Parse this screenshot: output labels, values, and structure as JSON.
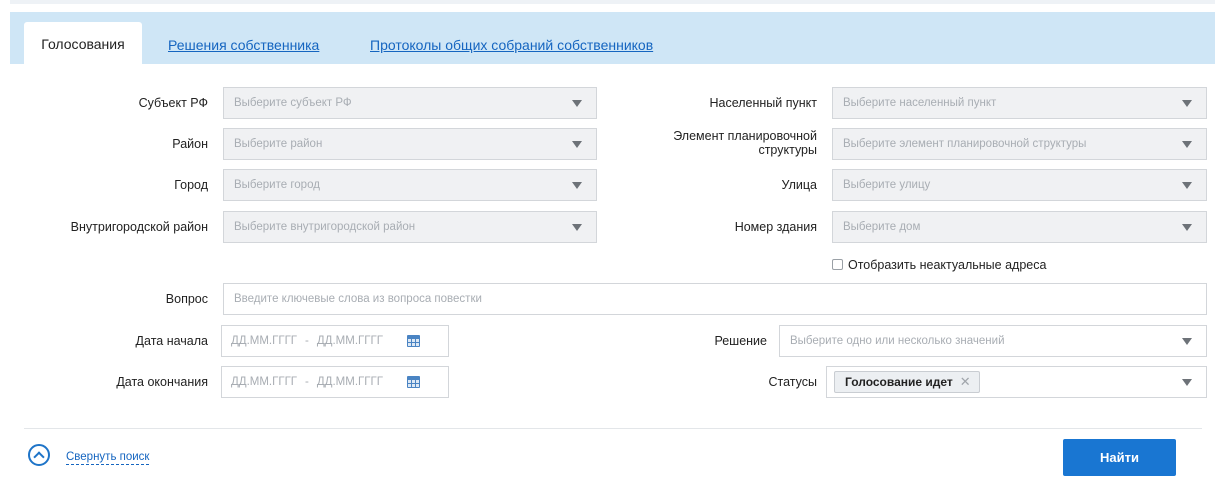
{
  "tabs": [
    {
      "label": "Голосования",
      "active": true
    },
    {
      "label": "Решения собственника",
      "active": false
    },
    {
      "label": "Протоколы общих собраний собственников",
      "active": false
    }
  ],
  "filters": {
    "subject": {
      "label": "Субъект РФ",
      "placeholder": "Выберите субъект РФ"
    },
    "district": {
      "label": "Район",
      "placeholder": "Выберите район"
    },
    "city": {
      "label": "Город",
      "placeholder": "Выберите город"
    },
    "inner_district": {
      "label": "Внутригородской район",
      "placeholder": "Выберите внутригородской район"
    },
    "locality": {
      "label": "Населенный пункт",
      "placeholder": "Выберите населенный пункт"
    },
    "planning_element": {
      "label_line1": "Элемент планировочной",
      "label_line2": "структуры",
      "placeholder": "Выберите элемент планировочной структуры"
    },
    "street": {
      "label": "Улица",
      "placeholder": "Выберите улицу"
    },
    "building": {
      "label": "Номер здания",
      "placeholder": "Выберите дом"
    },
    "show_outdated": {
      "label": "Отобразить неактуальные адреса",
      "checked": false
    },
    "question": {
      "label": "Вопрос",
      "placeholder": "Введите ключевые слова из вопроса повестки"
    },
    "start_date": {
      "label": "Дата начала",
      "from_placeholder": "ДД.ММ.ГГГГ",
      "separator": "-",
      "to_placeholder": "ДД.ММ.ГГГГ"
    },
    "end_date": {
      "label": "Дата окончания",
      "from_placeholder": "ДД.ММ.ГГГГ",
      "separator": "-",
      "to_placeholder": "ДД.ММ.ГГГГ"
    },
    "decision": {
      "label": "Решение",
      "placeholder": "Выберите одно или несколько значений"
    },
    "statuses": {
      "label": "Статусы",
      "selected": [
        "Голосование идет"
      ]
    }
  },
  "footer": {
    "collapse_label": "Свернуть поиск",
    "find_label": "Найти"
  },
  "colors": {
    "accent": "#1976d2",
    "link": "#1565c0",
    "tabbar": "#cfe6f6",
    "field_disabled": "#f0f1f3"
  },
  "icons": [
    "caret-down-icon",
    "calendar-icon",
    "remove-chip-icon",
    "collapse-up-icon"
  ]
}
